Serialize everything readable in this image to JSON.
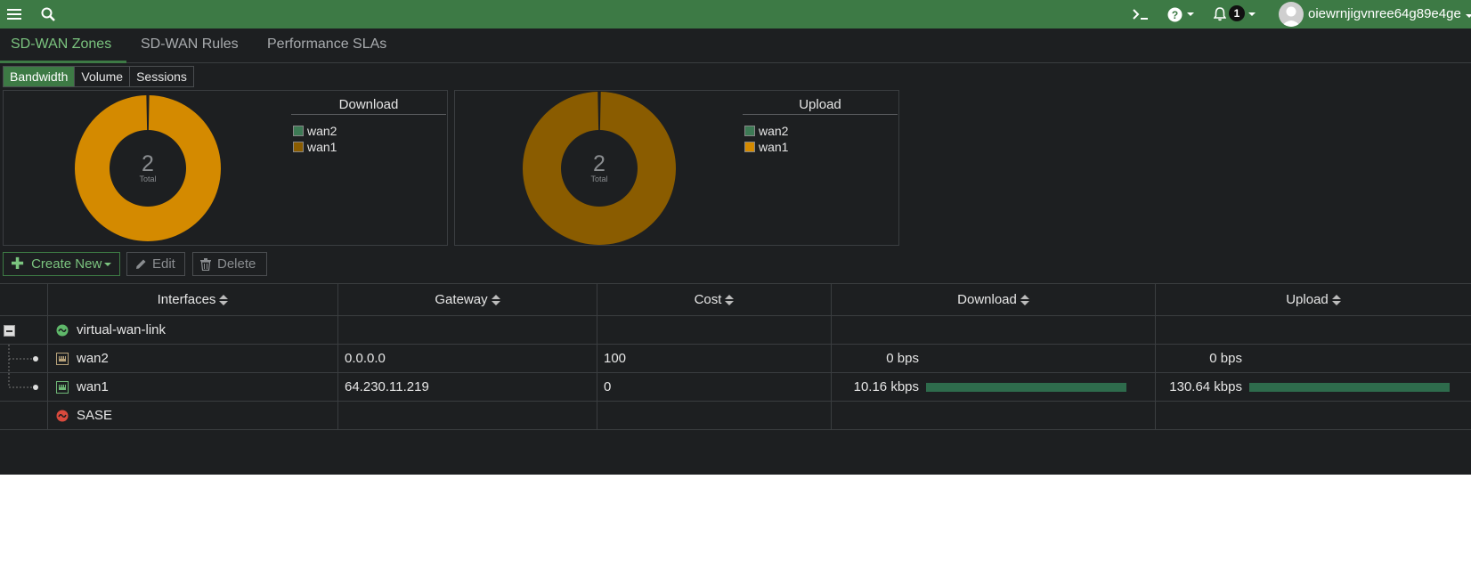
{
  "topbar": {
    "menu_icon": "hamburger-menu-icon",
    "search_icon": "search-icon",
    "cli_icon": "terminal-icon",
    "help_icon": "help-circle-icon",
    "bell_icon": "bell-icon",
    "notification_count": "1",
    "username": "oiewrnjigvnree64g89e4ge"
  },
  "tabs": [
    {
      "label": "SD-WAN Zones",
      "active": true
    },
    {
      "label": "SD-WAN Rules",
      "active": false
    },
    {
      "label": "Performance SLAs",
      "active": false
    }
  ],
  "subtabs": [
    {
      "label": "Bandwidth",
      "active": true
    },
    {
      "label": "Volume",
      "active": false
    },
    {
      "label": "Sessions",
      "active": false
    }
  ],
  "charts": [
    {
      "title": "Download",
      "total_value": "2",
      "total_label": "Total",
      "legend": [
        {
          "label": "wan2",
          "color": "#3d7a55"
        },
        {
          "label": "wan1",
          "color": "#d48a00"
        }
      ]
    },
    {
      "title": "Upload",
      "total_value": "2",
      "total_label": "Total",
      "legend": [
        {
          "label": "wan2",
          "color": "#3d7a55"
        },
        {
          "label": "wan1",
          "color": "#d48a00"
        }
      ]
    }
  ],
  "chart_data": [
    {
      "type": "pie",
      "title": "Download",
      "categories": [
        "wan2",
        "wan1"
      ],
      "values": [
        0,
        10.16
      ],
      "colors": [
        "#3d7a55",
        "#d48a00"
      ]
    },
    {
      "type": "pie",
      "title": "Upload",
      "categories": [
        "wan2",
        "wan1"
      ],
      "values": [
        0,
        130.64
      ],
      "colors": [
        "#3d7a55",
        "#8a5c00"
      ]
    }
  ],
  "toolbar": {
    "create_label": "Create New",
    "edit_label": "Edit",
    "delete_label": "Delete"
  },
  "table": {
    "headers": [
      "Interfaces",
      "Gateway",
      "Cost",
      "Download",
      "Upload"
    ],
    "rows": [
      {
        "name": "virtual-wan-link",
        "gateway": "",
        "cost": "",
        "download": "",
        "upload": "",
        "download_fraction": 0,
        "upload_fraction": 0
      },
      {
        "name": "wan2",
        "gateway": "0.0.0.0",
        "cost": "100",
        "download": "0 bps",
        "upload": "0 bps",
        "download_fraction": 0,
        "upload_fraction": 0
      },
      {
        "name": "wan1",
        "gateway": "64.230.11.219",
        "cost": "0",
        "download": "10.16 kbps",
        "upload": "130.64 kbps",
        "download_fraction": 1,
        "upload_fraction": 1
      },
      {
        "name": "SASE",
        "gateway": "",
        "cost": "",
        "download": "",
        "upload": "",
        "download_fraction": 0,
        "upload_fraction": 0
      }
    ]
  }
}
